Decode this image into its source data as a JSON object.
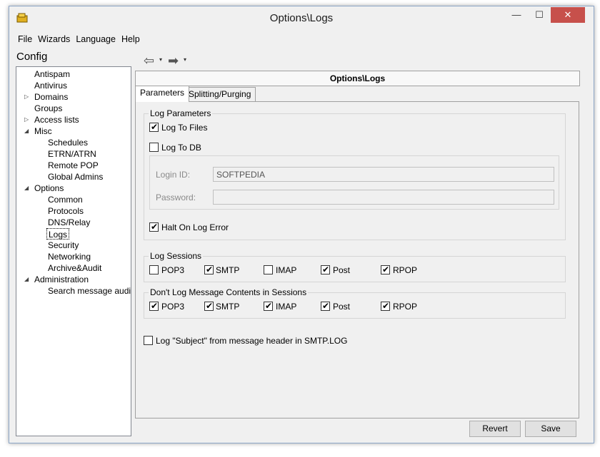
{
  "window": {
    "title": "Options\\Logs",
    "close_glyph": "✕",
    "minimize_glyph": "—",
    "maximize_glyph": "☐"
  },
  "menu": [
    "File",
    "Wizards",
    "Language",
    "Help"
  ],
  "sidebar": {
    "title": "Config",
    "items": [
      {
        "label": "Antispam"
      },
      {
        "label": "Antivirus"
      },
      {
        "label": "Domains"
      },
      {
        "label": "Groups"
      },
      {
        "label": "Access lists"
      },
      {
        "label": "Misc"
      },
      {
        "label": "Schedules"
      },
      {
        "label": "ETRN/ATRN"
      },
      {
        "label": "Remote POP"
      },
      {
        "label": "Global Admins"
      },
      {
        "label": "Options"
      },
      {
        "label": "Common"
      },
      {
        "label": "Protocols"
      },
      {
        "label": "DNS/Relay"
      },
      {
        "label": "Logs"
      },
      {
        "label": "Security"
      },
      {
        "label": "Networking"
      },
      {
        "label": "Archive&Audit"
      },
      {
        "label": "Administration"
      },
      {
        "label": "Search message audit"
      }
    ]
  },
  "toolbar": {
    "back_glyph": "⇦",
    "forward_glyph": "➡",
    "dropdown_glyph": "▾"
  },
  "header": {
    "title": "Options\\Logs"
  },
  "tabs": [
    {
      "label": "Parameters"
    },
    {
      "label": "Splitting/Purging"
    }
  ],
  "log_parameters": {
    "title": "Log Parameters",
    "log_to_files": {
      "label": "Log To Files",
      "checked": true
    },
    "log_to_db": {
      "label": "Log To DB",
      "checked": false
    },
    "login_id": {
      "label": "Login ID:",
      "value": "SOFTPEDIA"
    },
    "password": {
      "label": "Password:",
      "value": ""
    },
    "halt_on_error": {
      "label": "Halt On Log Error",
      "checked": true
    }
  },
  "log_sessions": {
    "title": "Log Sessions",
    "items": [
      {
        "label": "POP3",
        "checked": false
      },
      {
        "label": "SMTP",
        "checked": true
      },
      {
        "label": "IMAP",
        "checked": false
      },
      {
        "label": "Post",
        "checked": true
      },
      {
        "label": "RPOP",
        "checked": true
      }
    ]
  },
  "no_contents": {
    "title": "Don't Log Message Contents in Sessions",
    "items": [
      {
        "label": "POP3",
        "checked": true
      },
      {
        "label": "SMTP",
        "checked": true
      },
      {
        "label": "IMAP",
        "checked": true
      },
      {
        "label": "Post",
        "checked": true
      },
      {
        "label": "RPOP",
        "checked": true
      }
    ]
  },
  "log_subject": {
    "label": "Log \"Subject\" from message header in SMTP.LOG",
    "checked": false
  },
  "buttons": {
    "revert": "Revert",
    "save": "Save"
  },
  "check_glyph": "✔"
}
